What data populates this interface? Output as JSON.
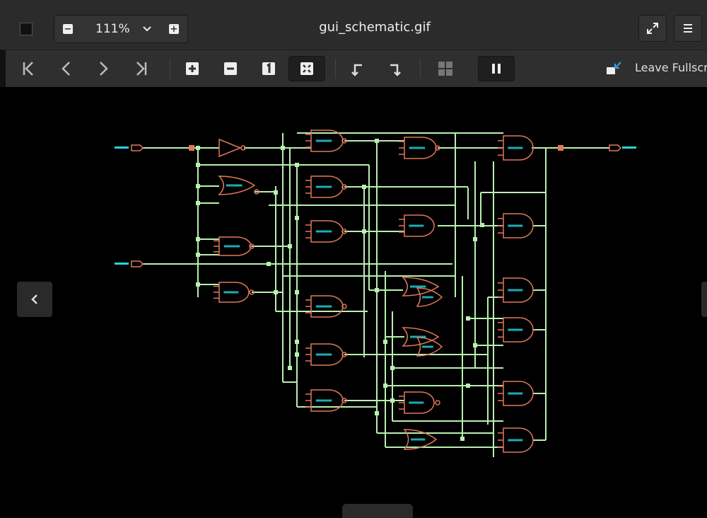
{
  "window": {
    "title": "gui_schematic.gif",
    "zoom_value": "111%",
    "zoom_out_icon": "minus-square-icon",
    "zoom_in_icon": "plus-square-icon",
    "fullscreen_icon": "expand-arrows-icon",
    "menu_icon": "hamburger-menu-icon"
  },
  "toolbar": {
    "leave_fullscreen_label": "Leave Fullscr",
    "buttons": [
      "first-image-icon",
      "previous-image-icon",
      "next-image-icon",
      "last-image-icon",
      "zoom-in-icon",
      "zoom-out-icon",
      "normal-size-icon",
      "best-fit-icon",
      "rotate-left-icon",
      "rotate-right-icon",
      "gallery-icon",
      "pause-slideshow-icon"
    ]
  },
  "schematic": {
    "colors": {
      "wire": "#b8f0b0",
      "gate": "#e0785a",
      "port_label": "#20d8e0",
      "background": "#000000"
    }
  }
}
